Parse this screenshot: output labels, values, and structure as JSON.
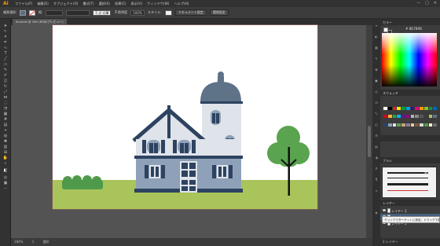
{
  "app": {
    "logo": "Ai"
  },
  "menu": [
    "ファイル(F)",
    "編集(E)",
    "オブジェクト(O)",
    "書式(T)",
    "選択(S)",
    "効果(C)",
    "表示(V)",
    "ウィンドウ(W)",
    "ヘルプ(H)"
  ],
  "window_controls": [
    "—",
    "□",
    "✕"
  ],
  "control_bar": {
    "label": "複数選択",
    "stroke_label": "線:",
    "brush_value": "5 点 丸筆",
    "style_field": "不透明度",
    "opacity": "100%",
    "style_label": "スタイル:",
    "doc_setup": "ドキュメント設定",
    "prefs": "環境設定"
  },
  "document_tab": "Illustrat @ 184 (RGB/プレビュー)",
  "statusbar": {
    "zoom": "184%",
    "page": "1",
    "tool": "選択"
  },
  "panels": {
    "color_head": "カラー",
    "color_hex": "# 8D7B9B",
    "swatch_head": "スウォッチ",
    "brush_head": "ブラシ",
    "brush_label": "基本",
    "layers_head": "レイヤー",
    "layers": [
      {
        "name": "レイヤー 1",
        "selected": false
      },
      {
        "name": "サンプル",
        "selected": true
      },
      {
        "name": "レイヤー 2",
        "selected": false
      }
    ],
    "tooltip": "クリックでターゲットに設定、ドラッグで移動",
    "footer": "2 レイヤー"
  },
  "colors": {
    "ground": "#a9c45a",
    "hedge": "#4f9a4a",
    "tree": "#5aa34f",
    "roof": "#2d4360",
    "dome": "#5e7288",
    "wall_upper": "#dfe3ea",
    "wall_lower": "#8fa1b8",
    "shutter": "#2d4360"
  }
}
